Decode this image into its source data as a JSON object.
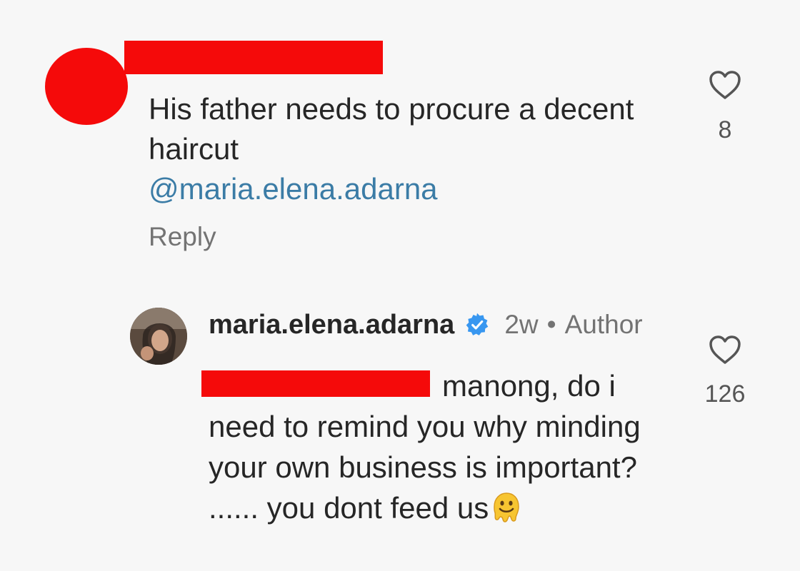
{
  "comment": {
    "text": "His father needs to procure a decent haircut",
    "mention": "@maria.elena.adarna",
    "reply_label": "Reply",
    "like_count": "8"
  },
  "reply": {
    "username": "maria.elena.adarna",
    "time": "2w",
    "separator": "•",
    "author_badge": "Author",
    "text": "manong, do i need to remind you why minding your own business is important? ...... you dont feed us",
    "emoji": "melting-face",
    "like_count": "126"
  },
  "colors": {
    "redaction": "#f50a0a",
    "mention": "#3b7ca6",
    "verified": "#3897f0",
    "muted": "#737373"
  },
  "icons": {
    "like": "heart-outline-icon",
    "verified": "verified-badge-icon"
  }
}
